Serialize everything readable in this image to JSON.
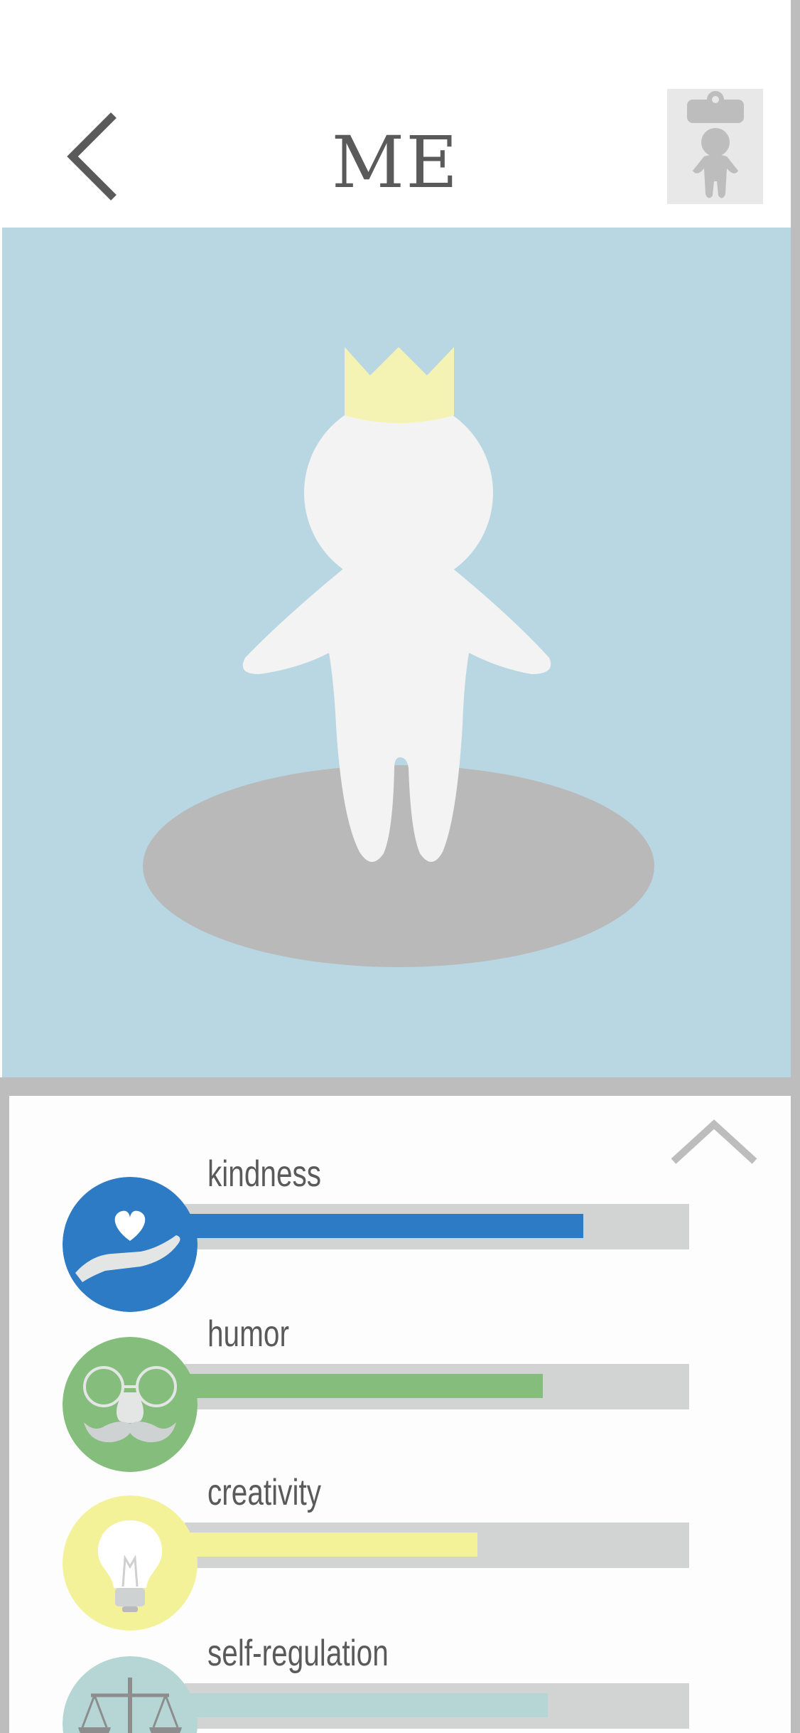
{
  "header": {
    "title": "ME"
  },
  "stats": [
    {
      "label": "kindness",
      "level": 0.79,
      "color": "#2d7bc4",
      "icon": "heart-in-hand-icon"
    },
    {
      "label": "humor",
      "level": 0.71,
      "color": "#85bd7c",
      "icon": "glasses-mustache-icon"
    },
    {
      "label": "creativity",
      "level": 0.58,
      "color": "#f3f298",
      "icon": "lightbulb-icon"
    },
    {
      "label": "self-regulation",
      "level": 0.72,
      "color": "#b6d6d6",
      "icon": "scales-icon"
    }
  ],
  "colors": {
    "hero_background": "#b9d7e2",
    "figure": "#f3f3f3",
    "crown": "#f5f3b3",
    "shadow": "#b9b9b9",
    "text": "#5a5a5a",
    "bar_track": "#d2d3d3"
  },
  "icons": {
    "back": "chevron-left-icon",
    "profile": "clipboard-person-icon",
    "collapse": "chevron-up-icon"
  }
}
